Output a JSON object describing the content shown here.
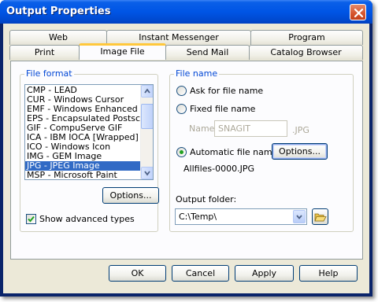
{
  "window": {
    "title": "Output Properties"
  },
  "tabs": {
    "row_back": [
      "Web",
      "Instant Messenger",
      "Program"
    ],
    "row_front": [
      "Print",
      "Image File",
      "Send Mail",
      "Catalog Browser"
    ],
    "active": "Image File"
  },
  "file_format": {
    "group_label": "File format",
    "items": [
      "CMP - LEAD",
      "CUR - Windows Cursor",
      "EMF - Windows Enhanced Met",
      "EPS - Encapsulated Postscript",
      "GIF - CompuServe GIF",
      "ICA - IBM IOCA [Wrapped]",
      "ICO - Windows Icon",
      "IMG - GEM Image",
      "JPG - JPEG Image",
      "MSP - Microsoft Paint"
    ],
    "selected": "JPG - JPEG Image",
    "options_button": "Options...",
    "advanced_types_label": "Show advanced types",
    "advanced_types_checked": true
  },
  "file_name": {
    "group_label": "File name",
    "ask_label": "Ask for file name",
    "fixed_label": "Fixed file name",
    "name_label": "Name:",
    "name_value": "SNAGIT",
    "extension": ".JPG",
    "automatic_label": "Automatic file name",
    "automatic_selected": true,
    "options_button": "Options...",
    "automatic_example": "Allfiles-0000.JPG",
    "output_folder_label": "Output folder:",
    "output_folder_value": "C:\\Temp\\"
  },
  "buttons": {
    "ok": "OK",
    "cancel": "Cancel",
    "apply": "Apply",
    "help": "Help"
  },
  "colors": {
    "titlebar": "#0055e5",
    "dialog_bg": "#ece9d8",
    "group_label": "#0046d5",
    "selection": "#316ac5",
    "tab_highlight": "#ffc83c"
  }
}
